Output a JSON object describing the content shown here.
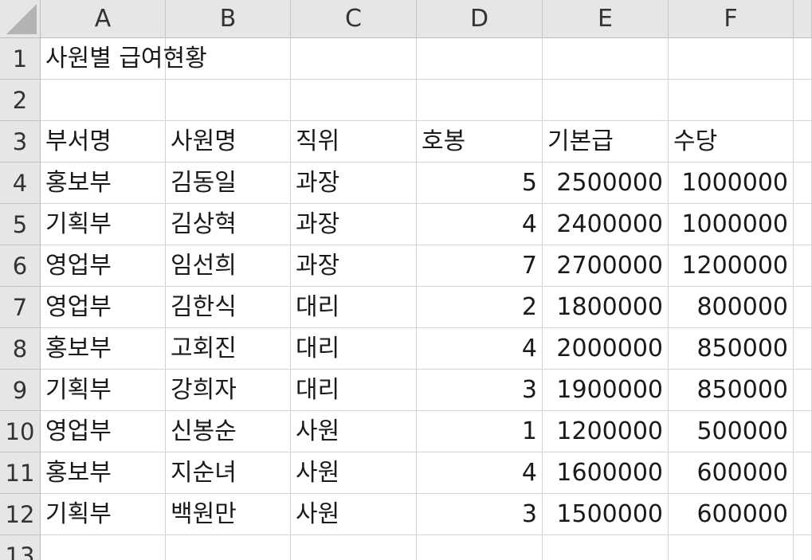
{
  "columns": [
    "A",
    "B",
    "C",
    "D",
    "E",
    "F"
  ],
  "rows": [
    "1",
    "2",
    "3",
    "4",
    "5",
    "6",
    "7",
    "8",
    "9",
    "10",
    "11",
    "12",
    "13"
  ],
  "title": "사원별 급여현황",
  "headers": [
    "부서명",
    "사원명",
    "직위",
    "호봉",
    "기본급",
    "수당"
  ],
  "records": [
    [
      "홍보부",
      "김동일",
      "과장",
      "5",
      "2500000",
      "1000000"
    ],
    [
      "기획부",
      "김상혁",
      "과장",
      "4",
      "2400000",
      "1000000"
    ],
    [
      "영업부",
      "임선희",
      "과장",
      "7",
      "2700000",
      "1200000"
    ],
    [
      "영업부",
      "김한식",
      "대리",
      "2",
      "1800000",
      "800000"
    ],
    [
      "홍보부",
      "고회진",
      "대리",
      "4",
      "2000000",
      "850000"
    ],
    [
      "기획부",
      "강희자",
      "대리",
      "3",
      "1900000",
      "850000"
    ],
    [
      "영업부",
      "신봉순",
      "사원",
      "1",
      "1200000",
      "500000"
    ],
    [
      "홍보부",
      "지순녀",
      "사원",
      "4",
      "1600000",
      "600000"
    ],
    [
      "기획부",
      "백원만",
      "사원",
      "3",
      "1500000",
      "600000"
    ]
  ]
}
